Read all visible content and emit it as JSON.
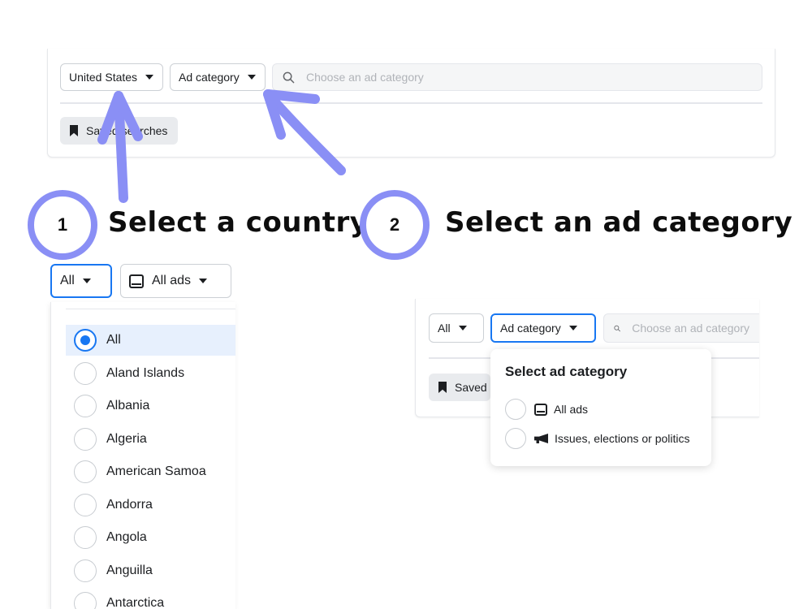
{
  "top_panel": {
    "country_label": "United States",
    "category_label": "Ad category",
    "search_placeholder": "Choose an ad category",
    "saved_label": "Saved searches"
  },
  "step1": {
    "number": "1",
    "text": "Select a country"
  },
  "step2": {
    "number": "2",
    "text": "Select an ad category"
  },
  "left_panel": {
    "country_label": "All",
    "ad_type_label": "All ads",
    "countries": [
      {
        "label": "All",
        "selected": true
      },
      {
        "label": "Aland Islands",
        "selected": false
      },
      {
        "label": "Albania",
        "selected": false
      },
      {
        "label": "Algeria",
        "selected": false
      },
      {
        "label": "American Samoa",
        "selected": false
      },
      {
        "label": "Andorra",
        "selected": false
      },
      {
        "label": "Angola",
        "selected": false
      },
      {
        "label": "Anguilla",
        "selected": false
      },
      {
        "label": "Antarctica",
        "selected": false
      }
    ]
  },
  "right_panel": {
    "country_label": "All",
    "category_label": "Ad category",
    "search_placeholder": "Choose an ad category",
    "saved_label": "Saved searches",
    "popover": {
      "title": "Select ad category",
      "options": [
        {
          "label": "All ads",
          "icon": "tablet-icon"
        },
        {
          "label": "Issues, elections or politics",
          "icon": "megaphone-icon"
        }
      ]
    }
  },
  "colors": {
    "annotation": "#8a8ff5",
    "accent": "#1877f2",
    "focus_border": "#1877f2"
  }
}
